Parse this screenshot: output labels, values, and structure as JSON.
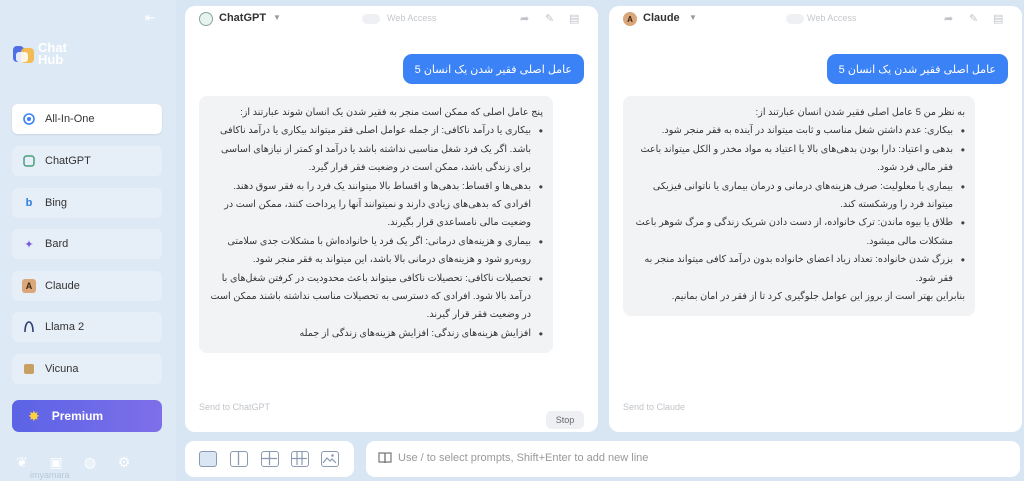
{
  "app": {
    "logo_line1": "Chat",
    "logo_line2": "Hub"
  },
  "sidebar": {
    "items": [
      {
        "label": "All-In-One"
      },
      {
        "label": "ChatGPT"
      },
      {
        "label": "Bing"
      },
      {
        "label": "Bard"
      },
      {
        "label": "Claude"
      },
      {
        "label": "Llama 2"
      },
      {
        "label": "Vicuna"
      }
    ],
    "premium_label": "Premium",
    "watermark": "imyamara"
  },
  "panels": {
    "left": {
      "bot_name": "ChatGPT",
      "web_access_label": "Web Access",
      "user_message": "عامل اصلی فقیر شدن یک انسان 5",
      "response_intro": "پنج عامل اصلی که ممکن است منجر به فقیر شدن یک انسان شوند عبارتند از:",
      "response_items": [
        "بیکاری یا درآمد ناکافی: از جمله عوامل اصلی فقر میتواند بیکاری یا درآمد ناکافی باشد. اگر یک فرد شغل مناسبی نداشته باشد یا درآمد او کمتر از نیازهای اساسی برای زندگی باشد، ممکن است در وضعیت فقر قرار گیرد.",
        "بدهی‌ها و اقساط: بدهی‌ها و اقساط بالا میتوانند یک فرد را به فقر سوق دهند. افرادی که بدهی‌های زیادی دارند و نمیتوانند آنها را پرداخت کنند، ممکن است در وضعیت مالی نامساعدی قرار بگیرند.",
        "بیماری و هزینه‌های درمانی: اگر یک فرد یا خانواده‌اش با مشکلات جدی سلامتی روبه‌رو شود و هزینه‌های درمانی بالا باشد، این میتواند به فقر منجر شود.",
        "تحصیلات ناکافی: تحصیلات ناکافی میتواند باعث محدودیت در کرفتن شغل‌های با درآمد بالا شود. افرادی که دسترسی به تحصیلات مناسب نداشته باشند ممکن است در وضعیت فقر قرار گیرند.",
        "افزایش هزینه‌های زندگی: افزایش هزینه‌های زندگی از جمله"
      ],
      "input_placeholder": "Send to ChatGPT",
      "stop_label": "Stop"
    },
    "right": {
      "bot_name": "Claude",
      "web_access_label": "Web Access",
      "user_message": "عامل اصلی فقیر شدن یک انسان 5",
      "response_intro": "به نظر من 5 عامل اصلی فقیر شدن انسان عبارتند از:",
      "response_items": [
        "بیکاری: عدم داشتن شغل مناسب و ثابت میتواند در آینده به فقر منجر شود.",
        "بدهی و اعتیاد: دارا بودن بدهی‌های بالا یا اعتیاد به مواد مخدر و الکل میتواند باعث فقر مالی فرد شود.",
        "بیماری یا معلولیت: صرف هزینه‌های درمانی و درمان بیماری یا ناتوانی فیزیکی میتواند فرد را ورشکسته کند.",
        "طلاق یا بیوه ماندن: ترک خانواده، از دست دادن شریک زندگی و مرگ شوهر باعث مشکلات مالی میشود.",
        "بزرگ شدن خانواده: تعداد زیاد اعضای خانواده بدون درآمد کافی میتواند منجر به فقر شود."
      ],
      "response_outro": "بنابراین بهتر است از بروز این عوامل جلوگیری کرد تا از فقر در امان بمانیم.",
      "input_placeholder": "Send to Claude"
    }
  },
  "prompt_bar": {
    "placeholder": "Use / to select prompts, Shift+Enter to add new line"
  }
}
